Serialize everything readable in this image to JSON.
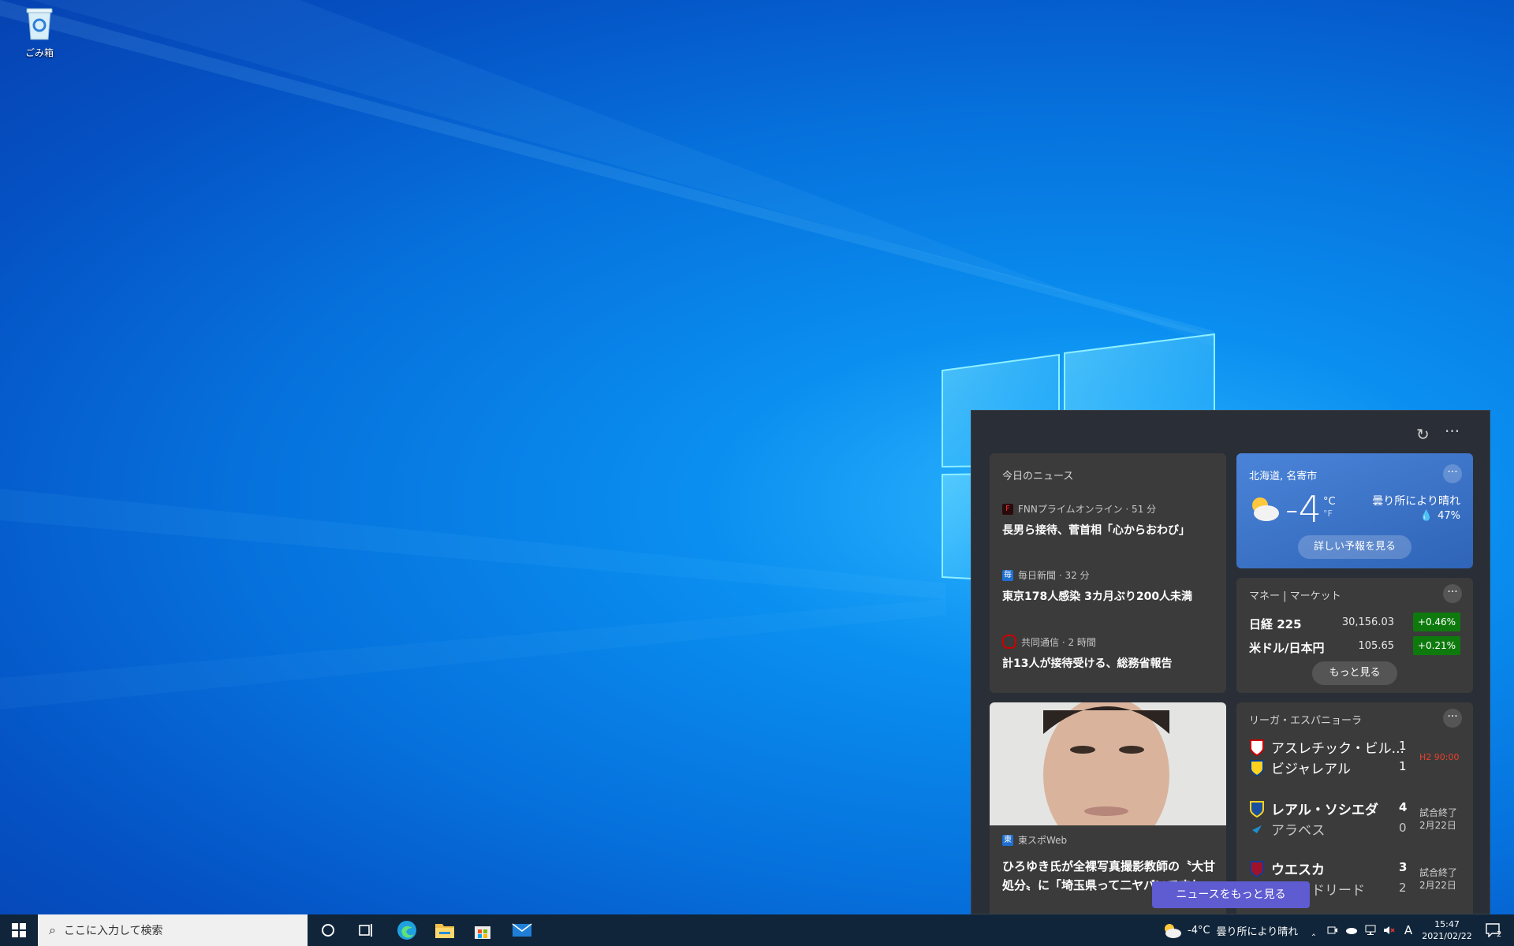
{
  "desktop": {
    "icons": [
      {
        "label": "ごみ箱",
        "icon": "recycle-bin-icon"
      }
    ]
  },
  "widget": {
    "header_icons": [
      "refresh-icon",
      "more-icon"
    ],
    "news": {
      "title": "今日のニュース",
      "items": [
        {
          "source": "FNNプライムオンライン · 51 分",
          "headline": "長男ら接待、菅首相「心からおわび」",
          "badge_color": "#c00000"
        },
        {
          "source": "毎日新聞 · 32 分",
          "headline": "東京178人感染 3カ月ぶり200人未満",
          "badge_color": "#1f6fd1"
        },
        {
          "source": "共同通信 · 2 時間",
          "headline": "計13人が接待受ける、総務省報告",
          "badge_color": "#c00000"
        }
      ]
    },
    "weather": {
      "location": "北海道, 名寄市",
      "temp": "-4",
      "unit_c": "°C",
      "unit_f": "°F",
      "condition": "曇り所により晴れ",
      "humidity": "47%",
      "forecast_button": "詳しい予報を見る",
      "more": "···"
    },
    "market": {
      "title": "マネー | マーケット",
      "more": "···",
      "rows": [
        {
          "name": "日経 225",
          "value": "30,156.03",
          "change": "+0.46%"
        },
        {
          "name": "米ドル/日本円",
          "value": "105.65",
          "change": "+0.21%"
        }
      ],
      "more_button": "もっと見る"
    },
    "photo_story": {
      "source": "東スポWeb",
      "headline": "ひろゆき氏が全裸写真撮影教師の〝大甘処分〟に「埼玉県って二ヤバいですね」"
    },
    "sports": {
      "title": "リーガ・エスパニョーラ",
      "more": "···",
      "matches": [
        {
          "home": "アスレチック・ビル...",
          "home_score": "1",
          "away": "ビジャレアル",
          "away_score": "1",
          "status": "H2 90:00"
        },
        {
          "home": "レアル・ソシエダ",
          "home_score": "4",
          "away": "アラベス",
          "away_score": "0",
          "status": "試合終了",
          "date": "2月22日"
        },
        {
          "home": "ウエスカ",
          "home_score": "3",
          "away": "バリャドリード",
          "away_score": "2",
          "status": "試合終了",
          "date": "2月22日"
        }
      ]
    },
    "more_news_button": "ニュースをもっと見る"
  },
  "taskbar": {
    "search_placeholder": "ここに入力して検索",
    "apps": [
      "start-icon",
      "cortana-icon",
      "task-view-icon",
      "edge-icon",
      "file-explorer-icon",
      "store-icon",
      "mail-icon"
    ],
    "weather_temp": "-4°C",
    "weather_text": "曇り所により晴れ",
    "ime": "A",
    "time": "15:47",
    "date": "2021/02/22",
    "notifications": "2"
  },
  "colors": {
    "panel_bg": "#2a2e36",
    "card_bg": "#3b3b3b",
    "weather_card": "#3b73c8",
    "positive": "#0e7a0d",
    "accent_button": "#5f5bd1",
    "live_status": "#e8402c"
  }
}
